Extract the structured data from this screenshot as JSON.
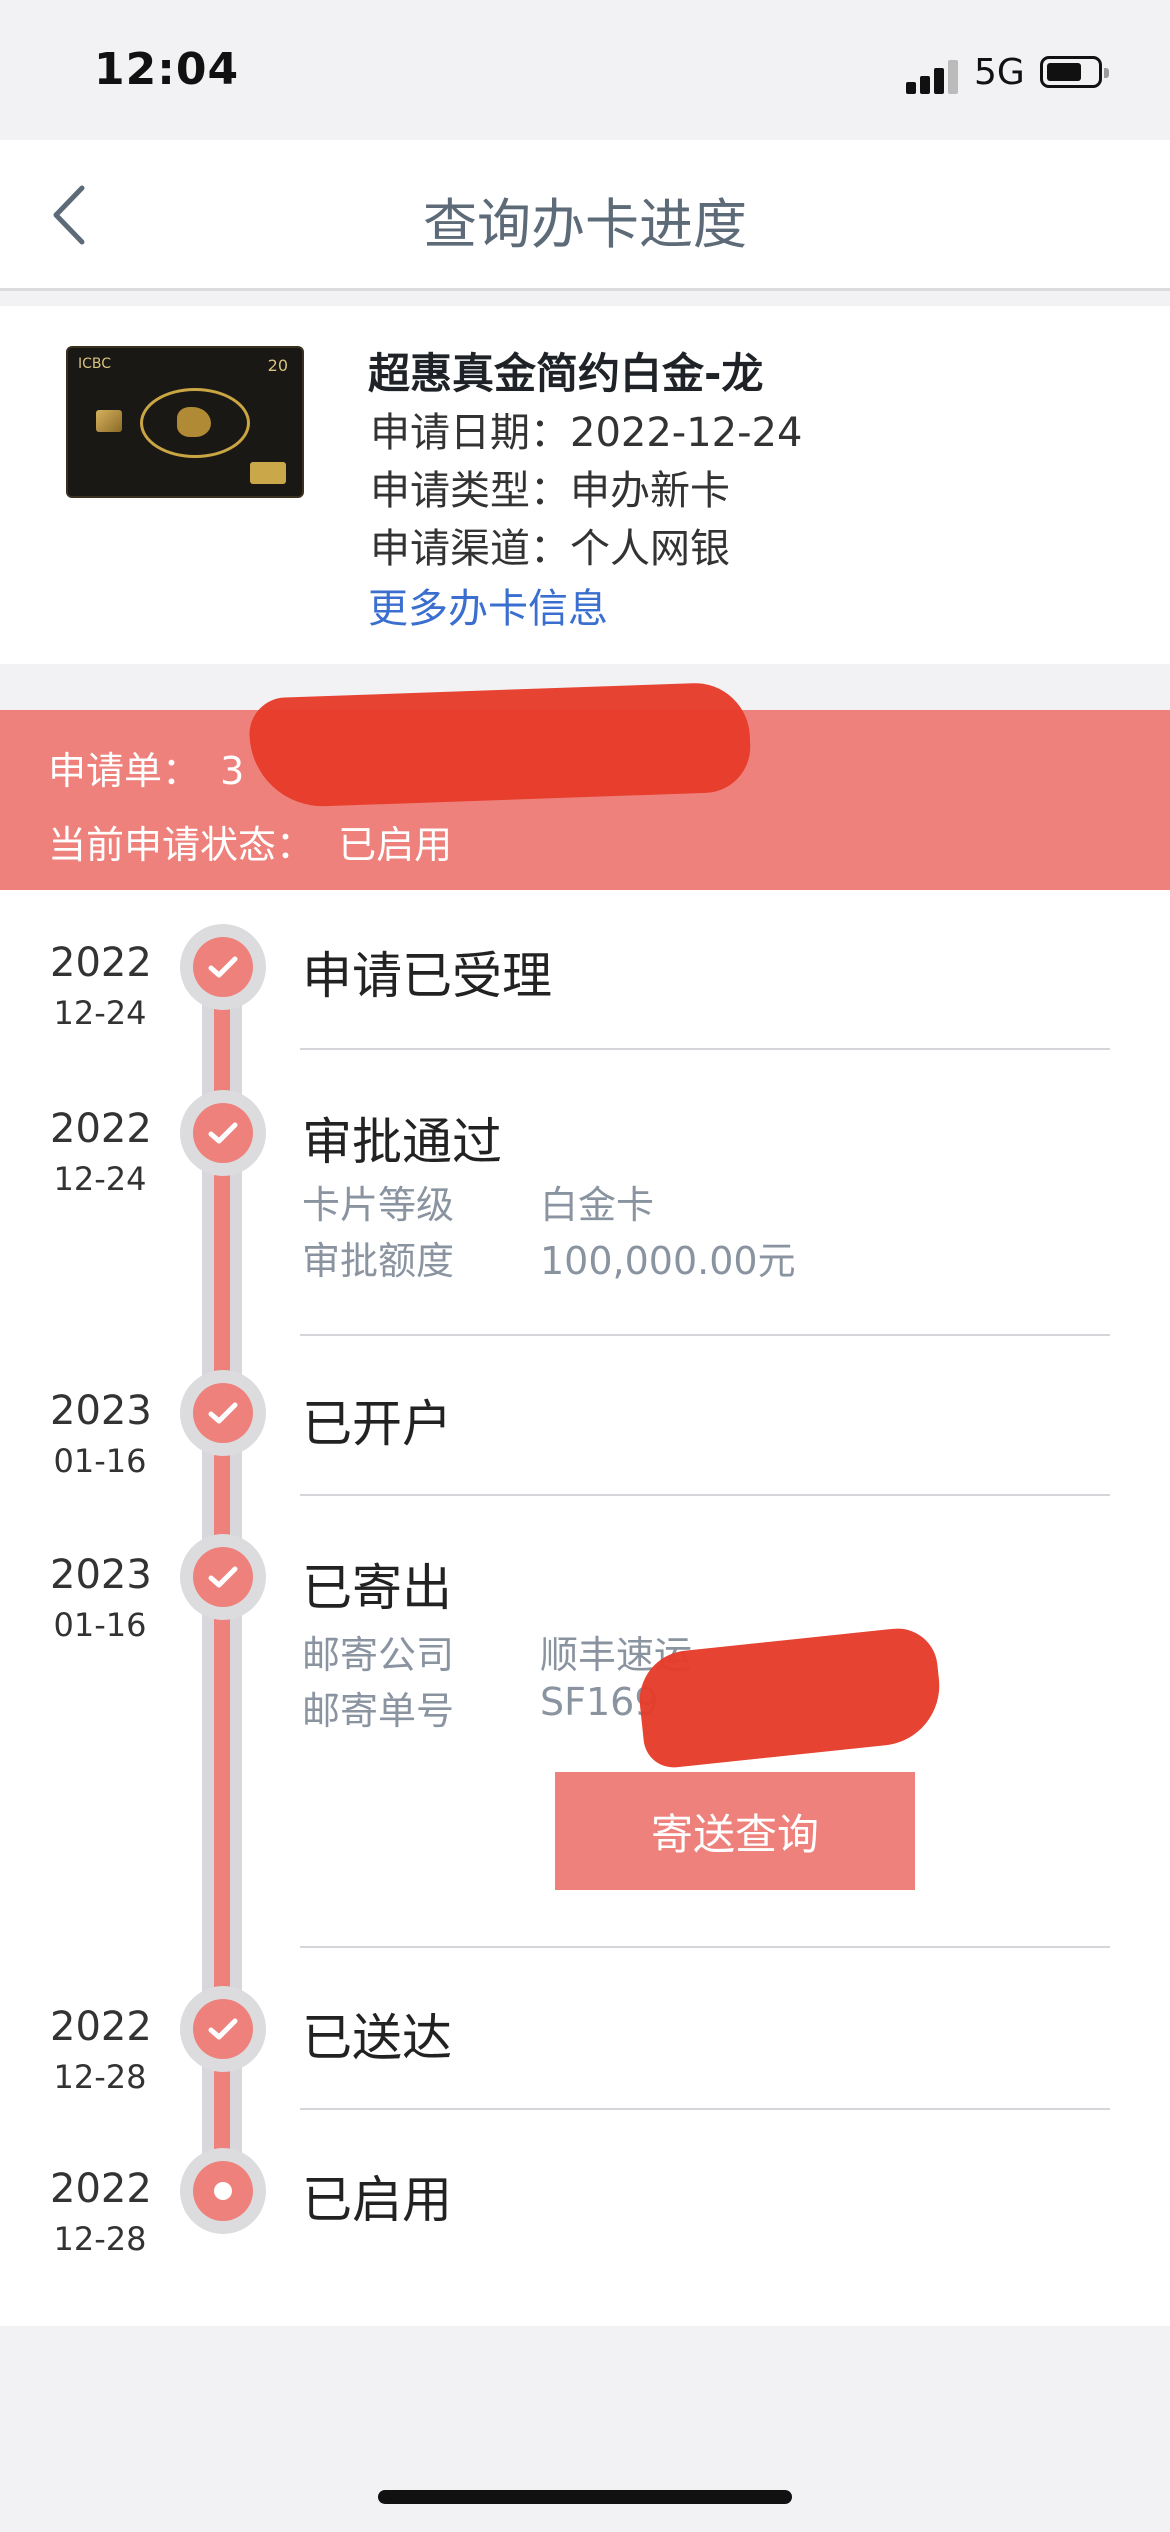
{
  "status_bar": {
    "time": "12:04",
    "network": "5G"
  },
  "nav": {
    "title": "查询办卡进度"
  },
  "card": {
    "name": "超惠真金简约白金-龙",
    "image_brand": "ICBC",
    "image_number": "20",
    "apply_date": "申请日期：2022-12-24",
    "apply_type": "申请类型：申办新卡",
    "apply_channel": "申请渠道：个人网银",
    "more_link": "更多办卡信息"
  },
  "application": {
    "id_label": "申请单：",
    "id_value_visible": "3",
    "status_label": "当前申请状态：",
    "status_value": "已启用"
  },
  "timeline": [
    {
      "year": "2022",
      "md": "12-24",
      "title": "申请已受理"
    },
    {
      "year": "2022",
      "md": "12-24",
      "title": "审批通过",
      "details": [
        {
          "label": "卡片等级",
          "value": "白金卡"
        },
        {
          "label": "审批额度",
          "value": "100,000.00元"
        }
      ]
    },
    {
      "year": "2023",
      "md": "01-16",
      "title": "已开户"
    },
    {
      "year": "2023",
      "md": "01-16",
      "title": "已寄出",
      "details": [
        {
          "label": "邮寄公司",
          "value": "顺丰速运"
        },
        {
          "label": "邮寄单号",
          "value": "SF169"
        }
      ],
      "button": "寄送查询"
    },
    {
      "year": "2022",
      "md": "12-28",
      "title": "已送达"
    },
    {
      "year": "2022",
      "md": "12-28",
      "title": "已启用"
    }
  ],
  "colors": {
    "accent": "#ee817b",
    "link": "#3a6fd0",
    "redaction": "#e63b2a"
  }
}
